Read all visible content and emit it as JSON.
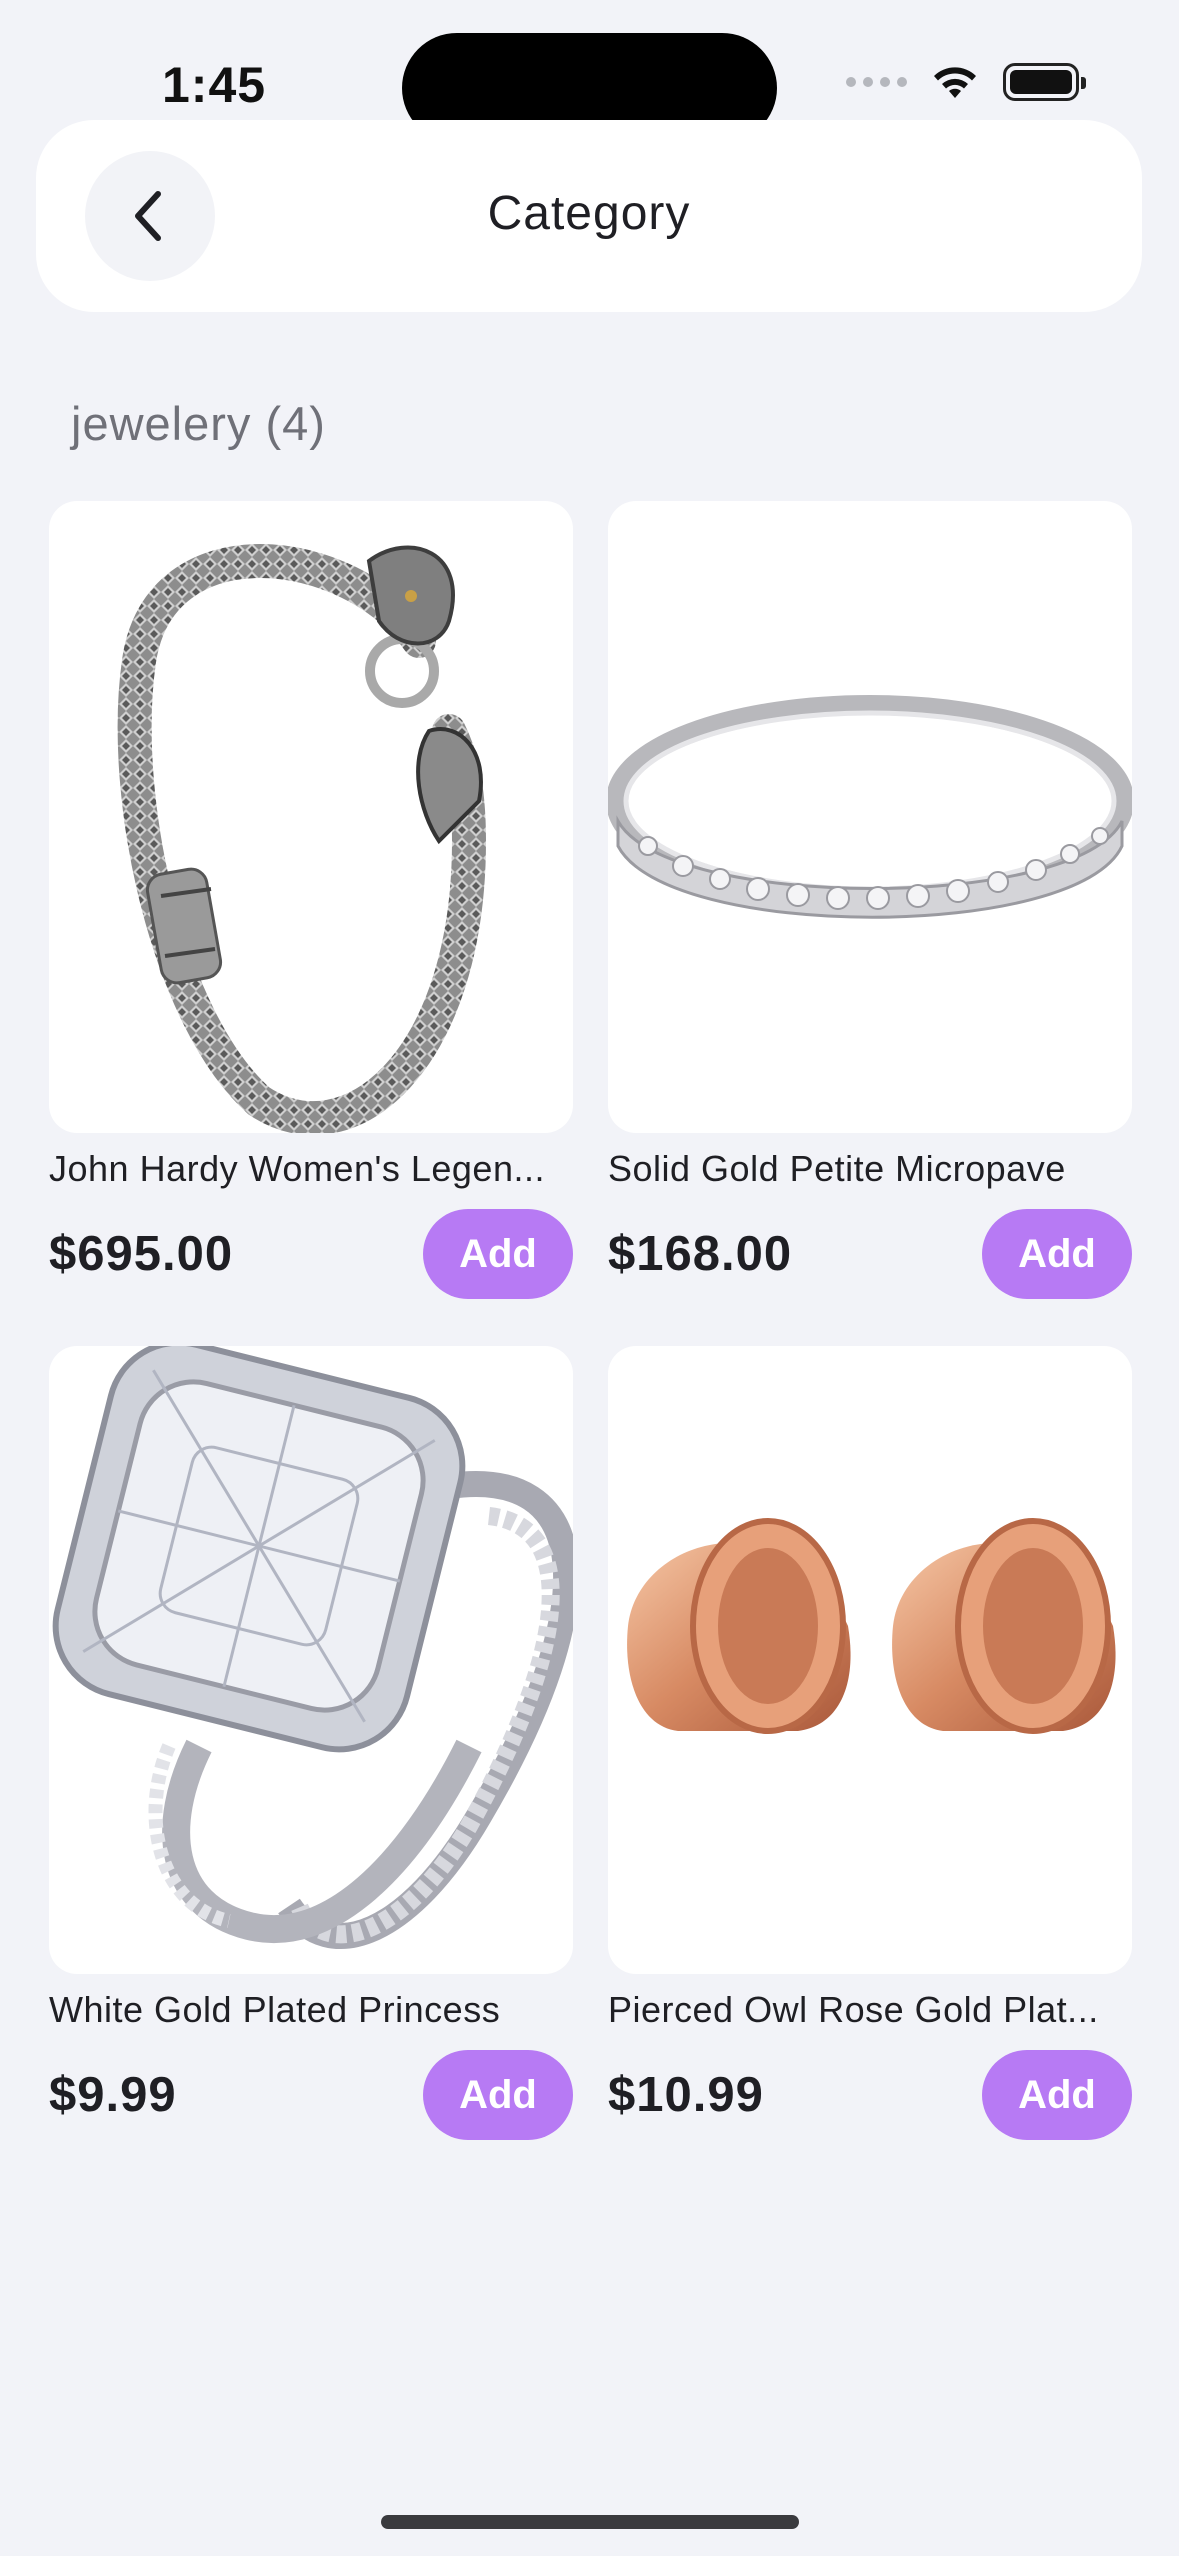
{
  "status_bar": {
    "time": "1:45"
  },
  "header": {
    "title": "Category"
  },
  "section": {
    "title": "jewelery (4)"
  },
  "products": [
    {
      "name": "John Hardy Women's Legen...",
      "price": "$695.00",
      "add_label": "Add",
      "image": "silver-dragon-chain-bracelet"
    },
    {
      "name": "Solid Gold Petite Micropave",
      "price": "$168.00",
      "add_label": "Add",
      "image": "silver-micropave-band-ring"
    },
    {
      "name": "White Gold Plated Princess",
      "price": "$9.99",
      "add_label": "Add",
      "image": "princess-cut-diamond-ring-set"
    },
    {
      "name": "Pierced Owl Rose Gold Plat...",
      "price": "$10.99",
      "add_label": "Add",
      "image": "rose-gold-tunnel-plugs"
    }
  ],
  "colors": {
    "accent": "#b77af4",
    "background": "#f2f3f8"
  }
}
